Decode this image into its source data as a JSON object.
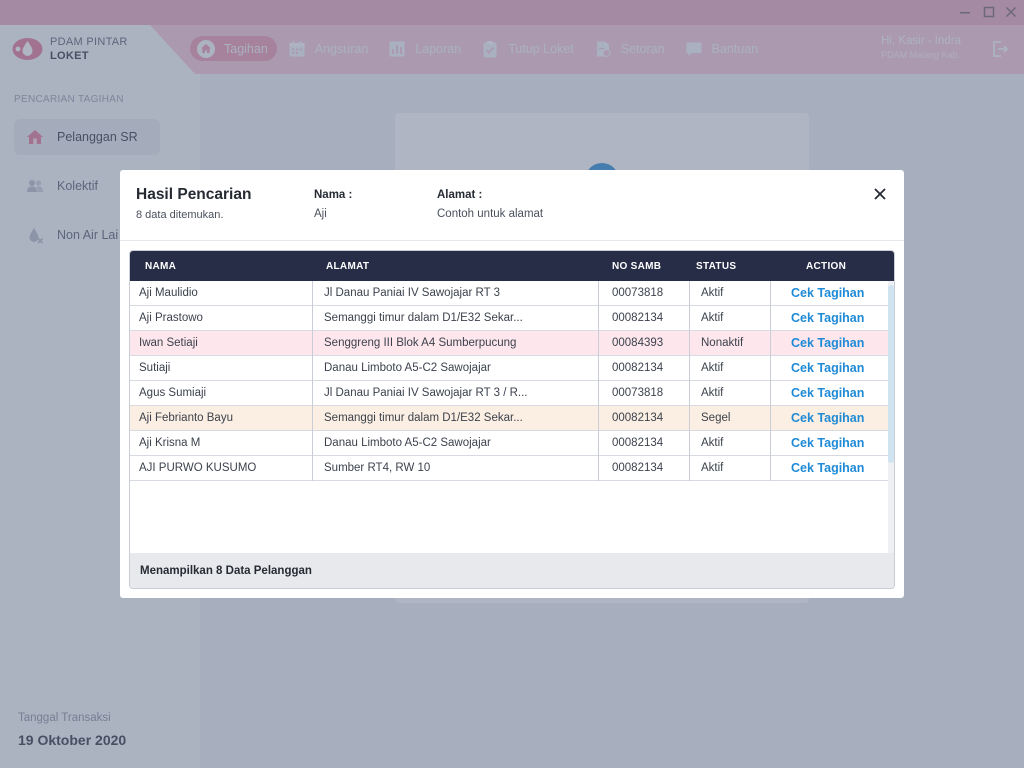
{
  "colors": {
    "accent_pink": "#f7c9d8",
    "nav_active": "#ec98b2",
    "table_header": "#272c47",
    "link_blue": "#1f8ad6",
    "row_pink": "#fde6ec",
    "row_peach": "#fbeee2"
  },
  "app": {
    "logo_line1": "PDAM PINTAR",
    "logo_line2": "LOKET",
    "logo_icon": "water-drop-logo-icon"
  },
  "window_controls": [
    "minimize-icon",
    "maximize-icon",
    "close-icon"
  ],
  "nav": [
    {
      "label": "Tagihan",
      "icon": "home-icon",
      "active": true
    },
    {
      "label": "Angsuran",
      "icon": "calendar-icon",
      "active": false
    },
    {
      "label": "Laporan",
      "icon": "bar-chart-icon",
      "active": false
    },
    {
      "label": "Tutup Loket",
      "icon": "clipboard-check-icon",
      "active": false
    },
    {
      "label": "Setoran",
      "icon": "document-money-icon",
      "active": false
    },
    {
      "label": "Bantuan",
      "icon": "chat-icon",
      "active": false
    }
  ],
  "user": {
    "greeting": "Hi, Kasir - Indra",
    "org": "PDAM Malang Kab."
  },
  "sidebar": {
    "heading": "PENCARIAN TAGIHAN",
    "items": [
      {
        "label": "Pelanggan SR",
        "icon": "house-icon",
        "active": true
      },
      {
        "label": "Kolektif",
        "icon": "people-icon",
        "active": false
      },
      {
        "label": "Non Air Lai",
        "icon": "water-off-icon",
        "active": false
      }
    ],
    "date_label": "Tanggal Transaksi",
    "date_value": "19 Oktober 2020"
  },
  "modal": {
    "title": "Hasil Pencarian",
    "subtitle": "8 data ditemukan.",
    "nama_label": "Nama :",
    "nama_value": "Aji",
    "alamat_label": "Alamat :",
    "alamat_value": "Contoh untuk alamat",
    "columns": [
      "NAMA",
      "ALAMAT",
      "NO SAMB",
      "STATUS",
      "ACTION"
    ],
    "rows": [
      {
        "nama": "Aji Maulidio",
        "alamat": "Jl Danau Paniai IV Sawojajar RT 3",
        "no_samb": "00073818",
        "status": "Aktif",
        "action": "Cek Tagihan",
        "highlight": ""
      },
      {
        "nama": "Aji Prastowo",
        "alamat": "Semanggi timur dalam D1/E32 Sekar...",
        "no_samb": "00082134",
        "status": "Aktif",
        "action": "Cek Tagihan",
        "highlight": ""
      },
      {
        "nama": "Iwan Setiaji",
        "alamat": "Senggreng III Blok A4 Sumberpucung",
        "no_samb": "00084393",
        "status": "Nonaktif",
        "action": "Cek Tagihan",
        "highlight": "pink"
      },
      {
        "nama": "Sutiaji",
        "alamat": "Danau Limboto A5-C2 Sawojajar",
        "no_samb": "00082134",
        "status": "Aktif",
        "action": "Cek Tagihan",
        "highlight": ""
      },
      {
        "nama": "Agus Sumiaji",
        "alamat": "Jl Danau Paniai IV Sawojajar RT 3 / R...",
        "no_samb": "00073818",
        "status": "Aktif",
        "action": "Cek Tagihan",
        "highlight": ""
      },
      {
        "nama": "Aji Febrianto Bayu",
        "alamat": "Semanggi timur dalam D1/E32 Sekar...",
        "no_samb": "00082134",
        "status": "Segel",
        "action": "Cek Tagihan",
        "highlight": "peach"
      },
      {
        "nama": "Aji Krisna M",
        "alamat": "Danau Limboto A5-C2 Sawojajar",
        "no_samb": "00082134",
        "status": "Aktif",
        "action": "Cek Tagihan",
        "highlight": ""
      },
      {
        "nama": "AJI PURWO KUSUMO",
        "alamat": "Sumber RT4, RW 10",
        "no_samb": "00082134",
        "status": "Aktif",
        "action": "Cek Tagihan",
        "highlight": ""
      }
    ],
    "footer": "Menampilkan 8 Data Pelanggan"
  }
}
